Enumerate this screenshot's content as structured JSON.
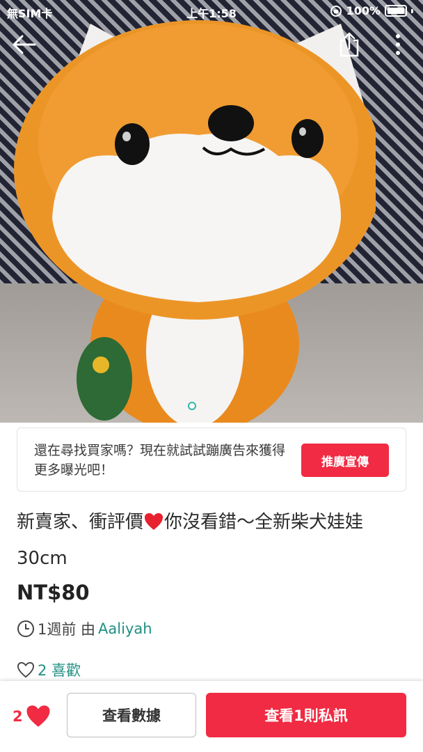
{
  "status_bar": {
    "carrier": "無SIM卡",
    "time": "上午1:58",
    "battery": "100%"
  },
  "photo": {
    "description_icon": "plush-shiba-photo",
    "page_indicator_count": 1,
    "page_indicator_active": 1
  },
  "nav": {
    "back_icon": "back-arrow-icon",
    "share_icon": "share-icon",
    "more_icon": "more-vertical-icon"
  },
  "promo": {
    "text": "還在尋找買家嗎？現在就試試蹦廣告來獲得更多曝光吧！",
    "button_label": "推廣宣傳"
  },
  "listing": {
    "title_before": "新賣家、衝評價",
    "title_after": "你沒看錯～全新柴犬娃娃30cm",
    "price": "NT$80",
    "posted_ago": "1週前 由 ",
    "seller": "Aaliyah",
    "likes_text": "2 喜歡"
  },
  "bottom_bar": {
    "like_count": "2",
    "view_data_label": "查看數據",
    "view_chat_label": "查看1則私訊"
  },
  "colors": {
    "accent_red": "#f02b43",
    "accent_teal": "#1f8f82"
  }
}
